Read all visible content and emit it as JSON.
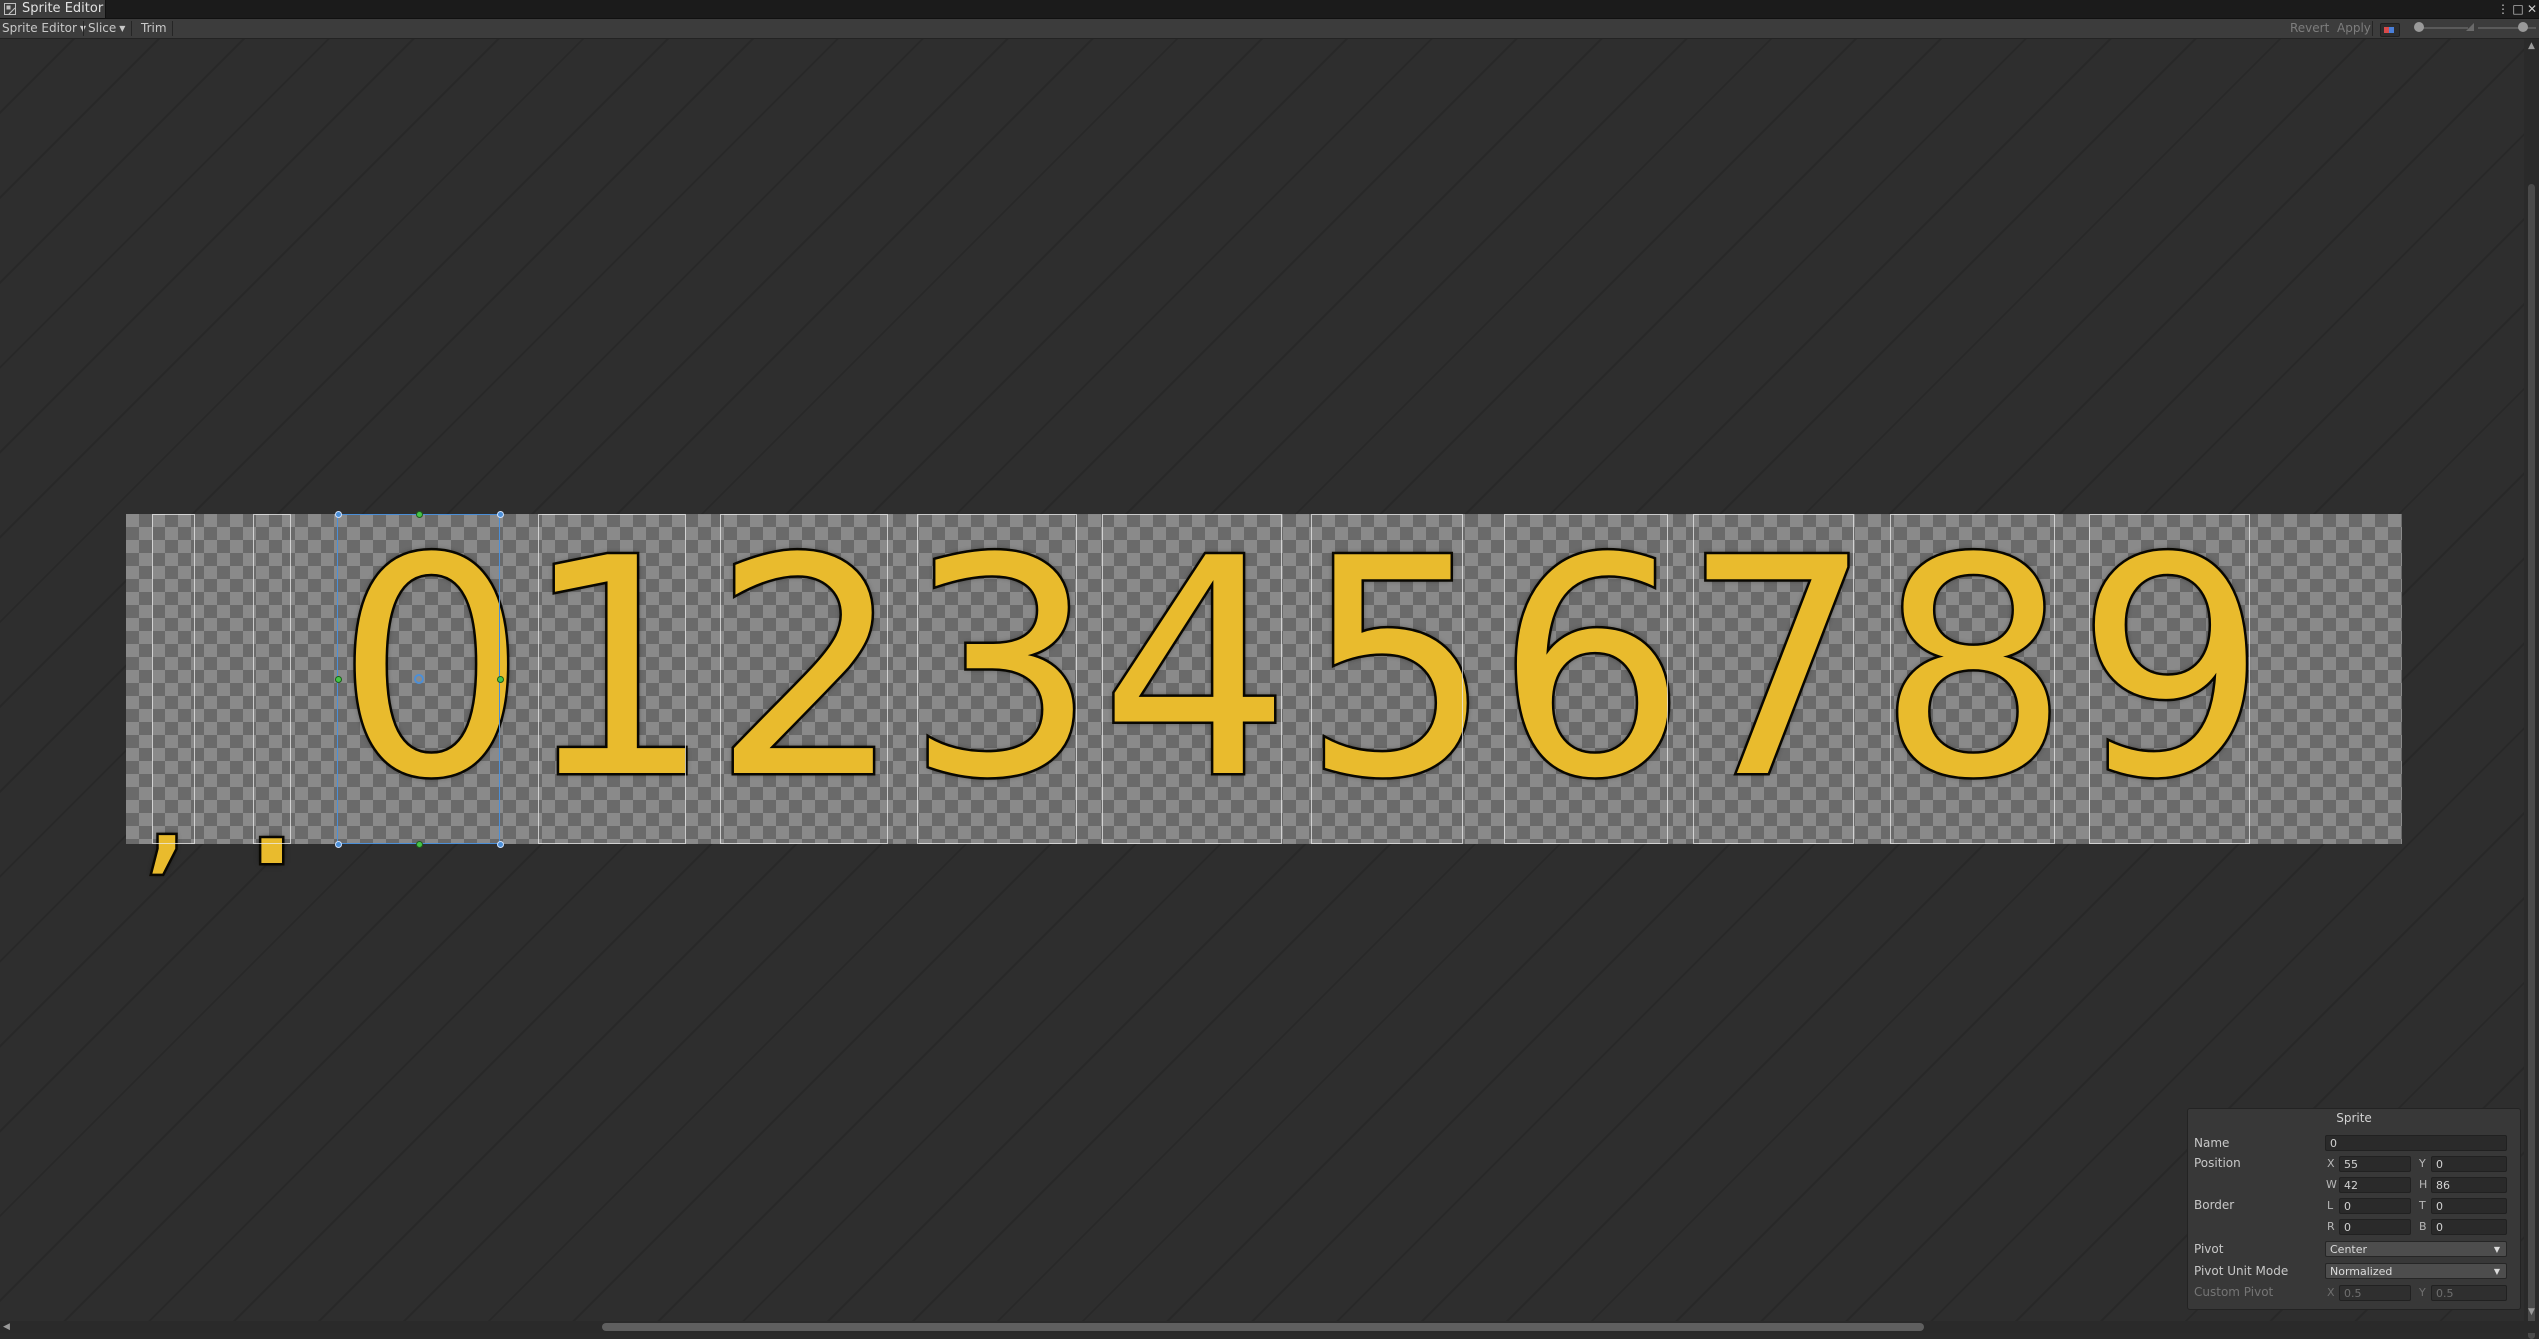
{
  "window": {
    "title": "Sprite Editor",
    "menu_icon": "⋮",
    "maximize_icon": "□",
    "close_icon": "✕"
  },
  "toolbar": {
    "mode_label": "Sprite Editor",
    "slice_label": "Slice",
    "trim_label": "Trim",
    "revert_label": "Revert",
    "apply_label": "Apply",
    "colors": {
      "red_channel": "#d84a4a",
      "blue_channel": "#4a7fd8"
    },
    "zoom_level": 0.78
  },
  "sprite_sheet": {
    "glyphs": [
      ",",
      ".",
      "0",
      "1",
      "2",
      "3",
      "4",
      "5",
      "6",
      "7",
      "8",
      "9"
    ],
    "selected_index": 2,
    "glyph_color": "#e9bb2d",
    "outline_color": "#0c0a03",
    "selection_color": "#4b8fd8",
    "handle_edge_color": "#47c447"
  },
  "sprite_panel": {
    "title": "Sprite",
    "name_label": "Name",
    "name_value": "0",
    "position_label": "Position",
    "x_label": "X",
    "x_value": "55",
    "y_label": "Y",
    "y_value": "0",
    "w_label": "W",
    "w_value": "42",
    "h_label": "H",
    "h_value": "86",
    "border_label": "Border",
    "l_label": "L",
    "l_value": "0",
    "t_label": "T",
    "t_value": "0",
    "r_label": "R",
    "r_value": "0",
    "b_label": "B",
    "b_value": "0",
    "pivot_label": "Pivot",
    "pivot_value": "Center",
    "pivot_unit_label": "Pivot Unit Mode",
    "pivot_unit_value": "Normalized",
    "custom_pivot_label": "Custom Pivot",
    "cx_label": "X",
    "cx_value": "0.5",
    "cy_label": "Y",
    "cy_value": "0.5"
  }
}
